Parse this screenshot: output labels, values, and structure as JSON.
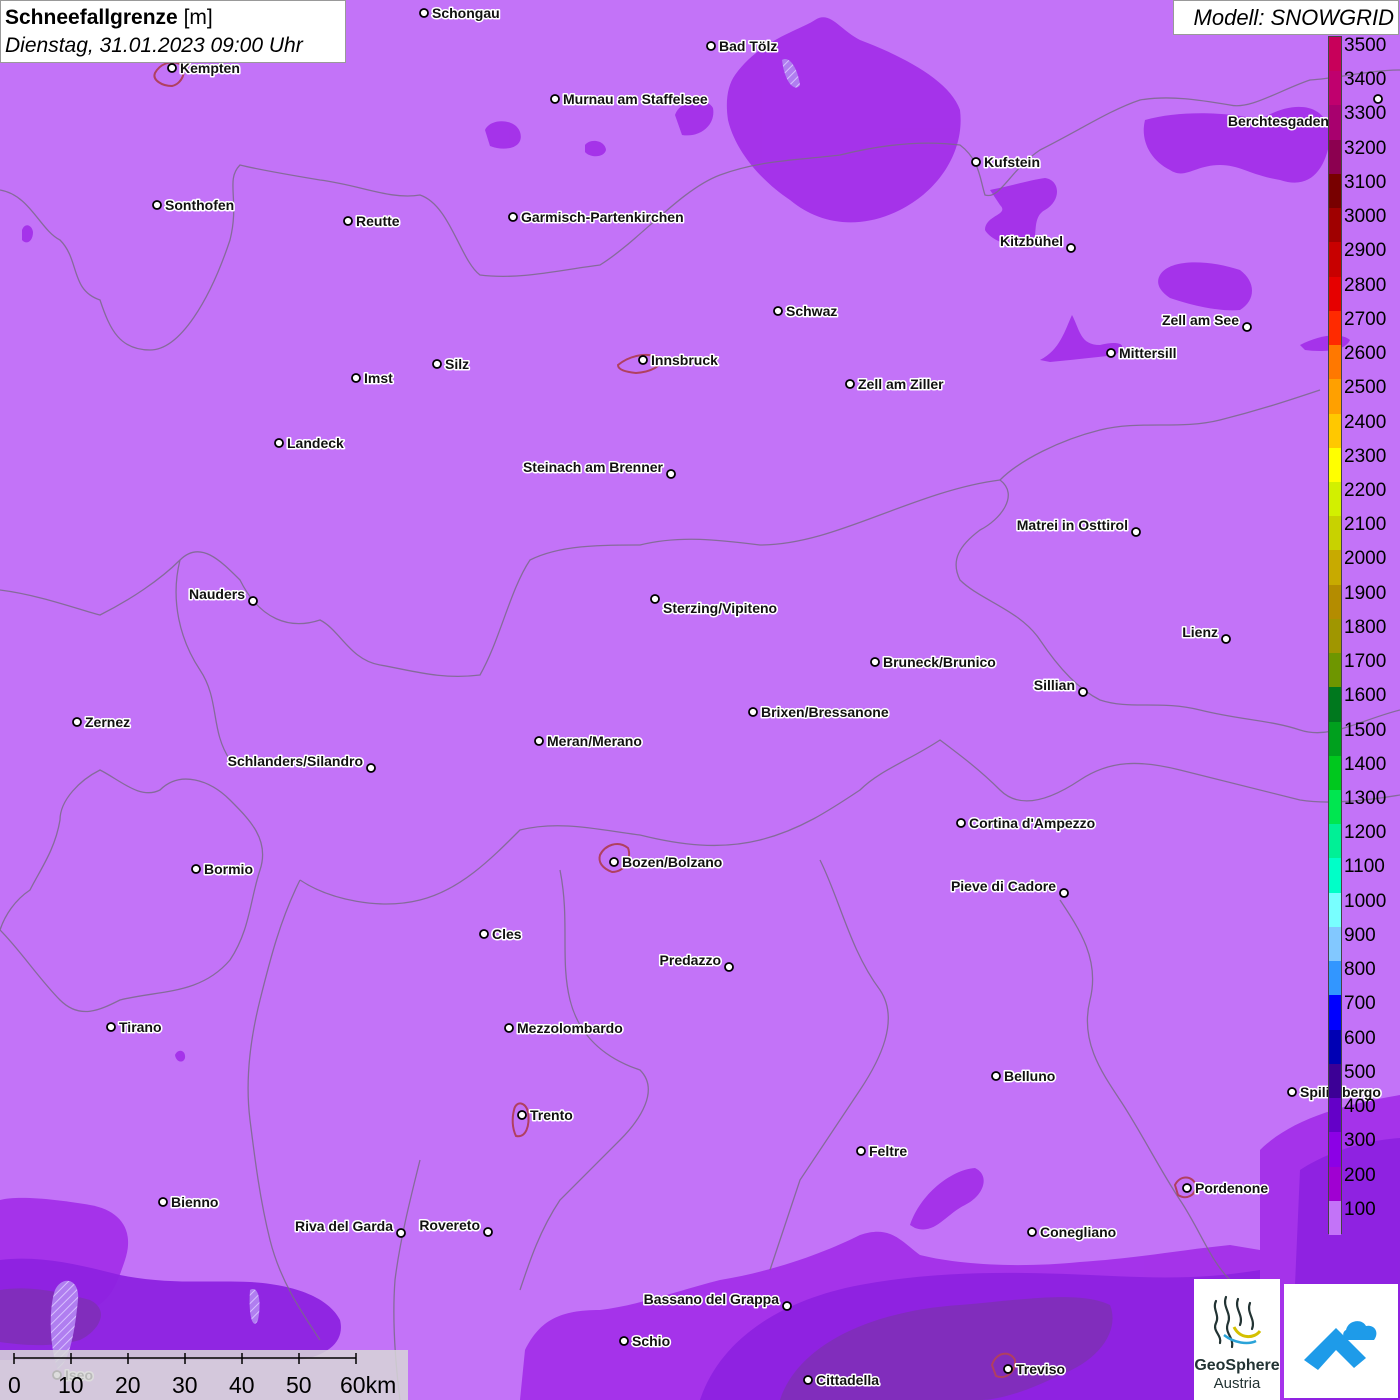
{
  "header": {
    "title_bold": "Schneefallgrenze",
    "title_unit": " [m]",
    "datetime": "Dienstag, 31.01.2023 09:00 Uhr",
    "model": "Modell: SNOWGRID"
  },
  "legend": {
    "unit": "m",
    "levels": [
      {
        "value": "3500",
        "color": "#c8005a"
      },
      {
        "value": "3400",
        "color": "#c0006e"
      },
      {
        "value": "3300",
        "color": "#a8006e"
      },
      {
        "value": "3200",
        "color": "#8c0050"
      },
      {
        "value": "3100",
        "color": "#780000"
      },
      {
        "value": "3000",
        "color": "#a00000"
      },
      {
        "value": "2900",
        "color": "#c80000"
      },
      {
        "value": "2800",
        "color": "#e60000"
      },
      {
        "value": "2700",
        "color": "#ff2a00"
      },
      {
        "value": "2600",
        "color": "#ff7800"
      },
      {
        "value": "2500",
        "color": "#ffa000"
      },
      {
        "value": "2400",
        "color": "#ffc800"
      },
      {
        "value": "2300",
        "color": "#ffff00"
      },
      {
        "value": "2200",
        "color": "#d2f000"
      },
      {
        "value": "2100",
        "color": "#c8d200"
      },
      {
        "value": "2000",
        "color": "#c8aa00"
      },
      {
        "value": "1900",
        "color": "#b48c00"
      },
      {
        "value": "1800",
        "color": "#a09600"
      },
      {
        "value": "1700",
        "color": "#6e9600"
      },
      {
        "value": "1600",
        "color": "#00781e"
      },
      {
        "value": "1500",
        "color": "#00a01e"
      },
      {
        "value": "1400",
        "color": "#00c81e"
      },
      {
        "value": "1300",
        "color": "#00e650"
      },
      {
        "value": "1200",
        "color": "#00f096"
      },
      {
        "value": "1100",
        "color": "#00ffc8"
      },
      {
        "value": "1000",
        "color": "#78ffff"
      },
      {
        "value": "900",
        "color": "#82c8ff"
      },
      {
        "value": "800",
        "color": "#3296ff"
      },
      {
        "value": "700",
        "color": "#0000ff"
      },
      {
        "value": "600",
        "color": "#0000b4"
      },
      {
        "value": "500",
        "color": "#3c0096"
      },
      {
        "value": "400",
        "color": "#6400c8"
      },
      {
        "value": "300",
        "color": "#8c00e6"
      },
      {
        "value": "200",
        "color": "#a000d2"
      },
      {
        "value": "100",
        "color": "#c373f8"
      }
    ]
  },
  "scale_bar": {
    "ticks": [
      "0",
      "10",
      "20",
      "30",
      "40",
      "50",
      "60km"
    ]
  },
  "logos": {
    "geosphere_line1": "GeoSphere",
    "geosphere_line2": "Austria"
  },
  "cities": [
    {
      "name": "Schongau"
    },
    {
      "name": "Bad Tölz"
    },
    {
      "name": "Kempten"
    },
    {
      "name": "Murnau am Staffelsee"
    },
    {
      "name": "Berchtesgaden"
    },
    {
      "name": "Kufstein"
    },
    {
      "name": "Sonthofen"
    },
    {
      "name": "Reutte"
    },
    {
      "name": "Garmisch-Partenkirchen"
    },
    {
      "name": "Kitzbühel"
    },
    {
      "name": "Schwaz"
    },
    {
      "name": "Zell am See"
    },
    {
      "name": "Mittersill"
    },
    {
      "name": "Innsbruck"
    },
    {
      "name": "Imst"
    },
    {
      "name": "Silz"
    },
    {
      "name": "Zell am Ziller"
    },
    {
      "name": "Landeck"
    },
    {
      "name": "Steinach am Brenner"
    },
    {
      "name": "Matrei in Osttirol"
    },
    {
      "name": "Nauders"
    },
    {
      "name": "Sterzing/Vipiteno"
    },
    {
      "name": "Lienz"
    },
    {
      "name": "Bruneck/Brunico"
    },
    {
      "name": "Sillian"
    },
    {
      "name": "Brixen/Bressanone"
    },
    {
      "name": "Zernez"
    },
    {
      "name": "Meran/Merano"
    },
    {
      "name": "Schlanders/Silandro"
    },
    {
      "name": "Cortina d'Ampezzo"
    },
    {
      "name": "Bozen/Bolzano"
    },
    {
      "name": "Bormio"
    },
    {
      "name": "Pieve di Cadore"
    },
    {
      "name": "Cles"
    },
    {
      "name": "Predazzo"
    },
    {
      "name": "Tirano"
    },
    {
      "name": "Mezzolombardo"
    },
    {
      "name": "Belluno"
    },
    {
      "name": "Spilimbergo"
    },
    {
      "name": "Trento"
    },
    {
      "name": "Feltre"
    },
    {
      "name": "Pordenone"
    },
    {
      "name": "Bienno"
    },
    {
      "name": "Riva del Garda"
    },
    {
      "name": "Rovereto"
    },
    {
      "name": "Conegliano"
    },
    {
      "name": "Bassano del Grappa"
    },
    {
      "name": "Schio"
    },
    {
      "name": "Iseo"
    },
    {
      "name": "Treviso"
    },
    {
      "name": "Cittadella"
    }
  ]
}
